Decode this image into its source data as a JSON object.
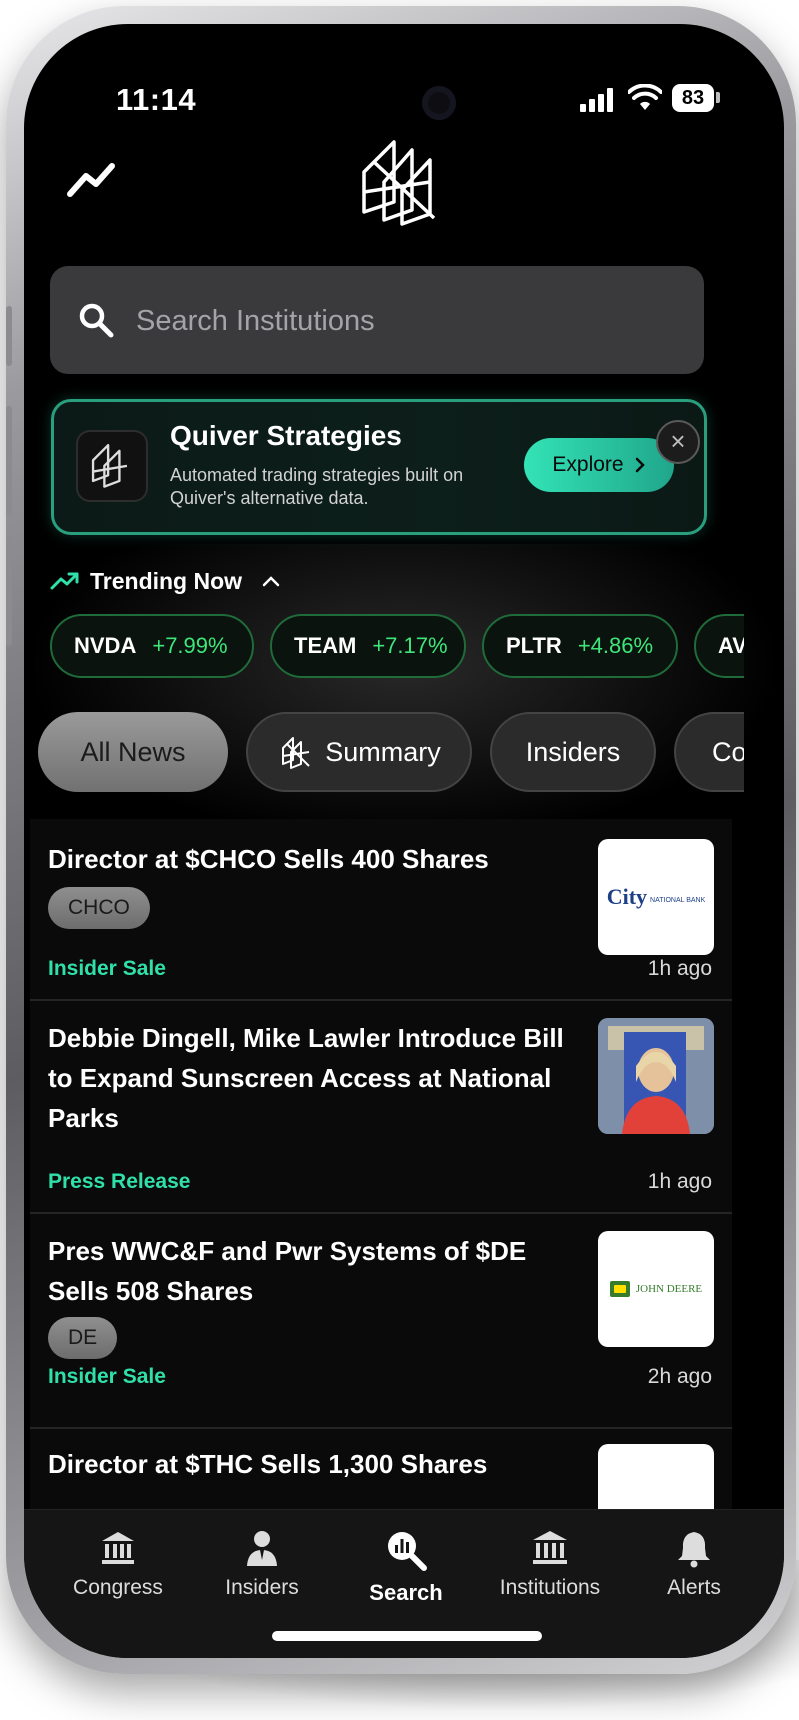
{
  "status_bar": {
    "time": "11:14",
    "battery": "83"
  },
  "search": {
    "placeholder": "Search Institutions"
  },
  "promo": {
    "title": "Quiver Strategies",
    "description": "Automated trading strategies built on Quiver's alternative data.",
    "button_label": "Explore",
    "close_label": "×"
  },
  "trending": {
    "heading": "Trending Now",
    "chips": [
      {
        "ticker": "NVDA",
        "change": "+7.99%"
      },
      {
        "ticker": "TEAM",
        "change": "+7.17%"
      },
      {
        "ticker": "PLTR",
        "change": "+4.86%"
      },
      {
        "ticker": "AVGO",
        "change": ""
      }
    ]
  },
  "filters": [
    "All News",
    "Summary",
    "Insiders",
    "Co"
  ],
  "feed": [
    {
      "title": "Director at $CHCO Sells 400 Shares",
      "ticker": "CHCO",
      "category": "Insider Sale",
      "time": "1h ago",
      "thumb_brand": "City",
      "thumb_sub": "NATIONAL BANK"
    },
    {
      "title": "Debbie Dingell, Mike Lawler Introduce Bill to Expand Sunscreen Access at National Parks",
      "category": "Press Release",
      "time": "1h ago"
    },
    {
      "title": "Pres WWC&F and Pwr Systems of $DE Sells 508 Shares",
      "ticker": "DE",
      "category": "Insider Sale",
      "time": "2h ago",
      "thumb_brand": "JOHN DEERE"
    },
    {
      "title": "Director at $THC Sells 1,300 Shares"
    }
  ],
  "tabbar": [
    {
      "label": "Congress",
      "icon": "capitol-icon"
    },
    {
      "label": "Insiders",
      "icon": "person-icon"
    },
    {
      "label": "Search",
      "icon": "search-chart-icon",
      "active": true
    },
    {
      "label": "Institutions",
      "icon": "bank-icon"
    },
    {
      "label": "Alerts",
      "icon": "bell-icon"
    }
  ],
  "colors": {
    "accent": "#2fe0a8",
    "positive": "#3ee67a",
    "background": "#000000"
  }
}
